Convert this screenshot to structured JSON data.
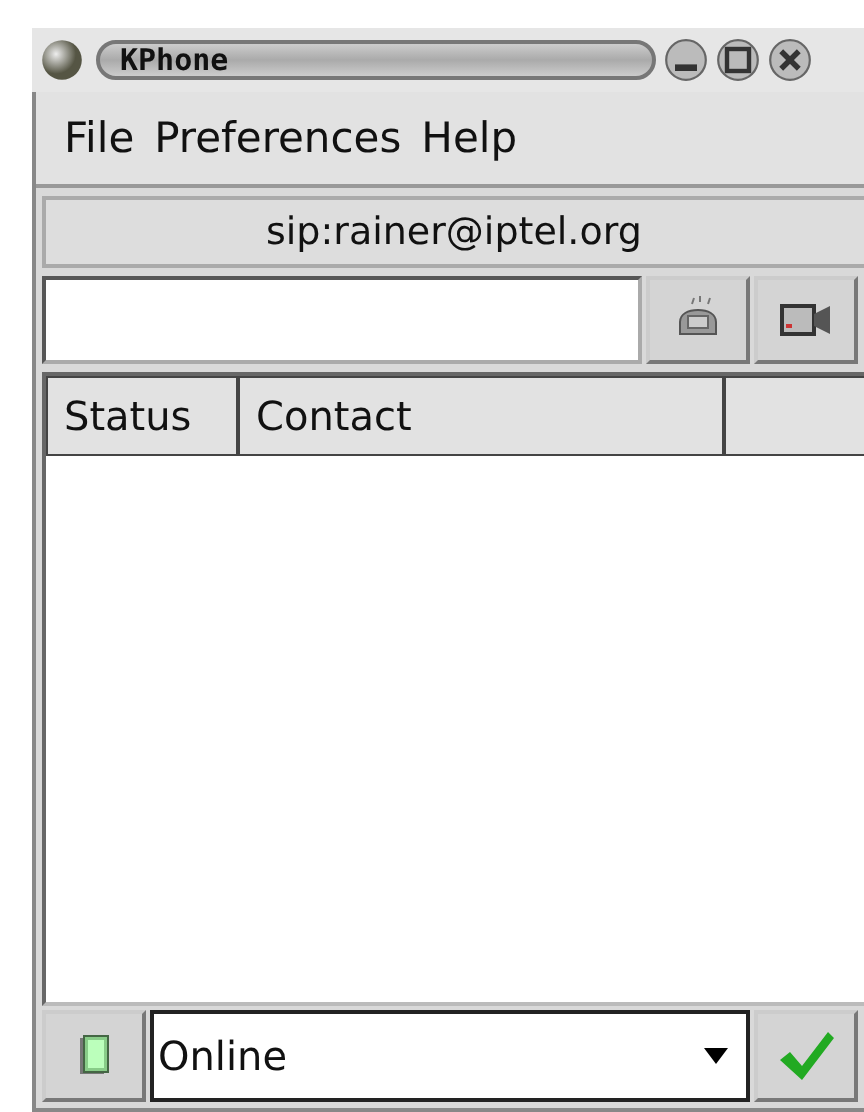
{
  "window": {
    "title": "KPhone"
  },
  "menu": [
    "File",
    "Preferences",
    "Help"
  ],
  "identity_button": "sip:rainer@iptel.org",
  "columns": [
    "Status",
    "Contact"
  ],
  "status_combo": {
    "value": "Online"
  }
}
